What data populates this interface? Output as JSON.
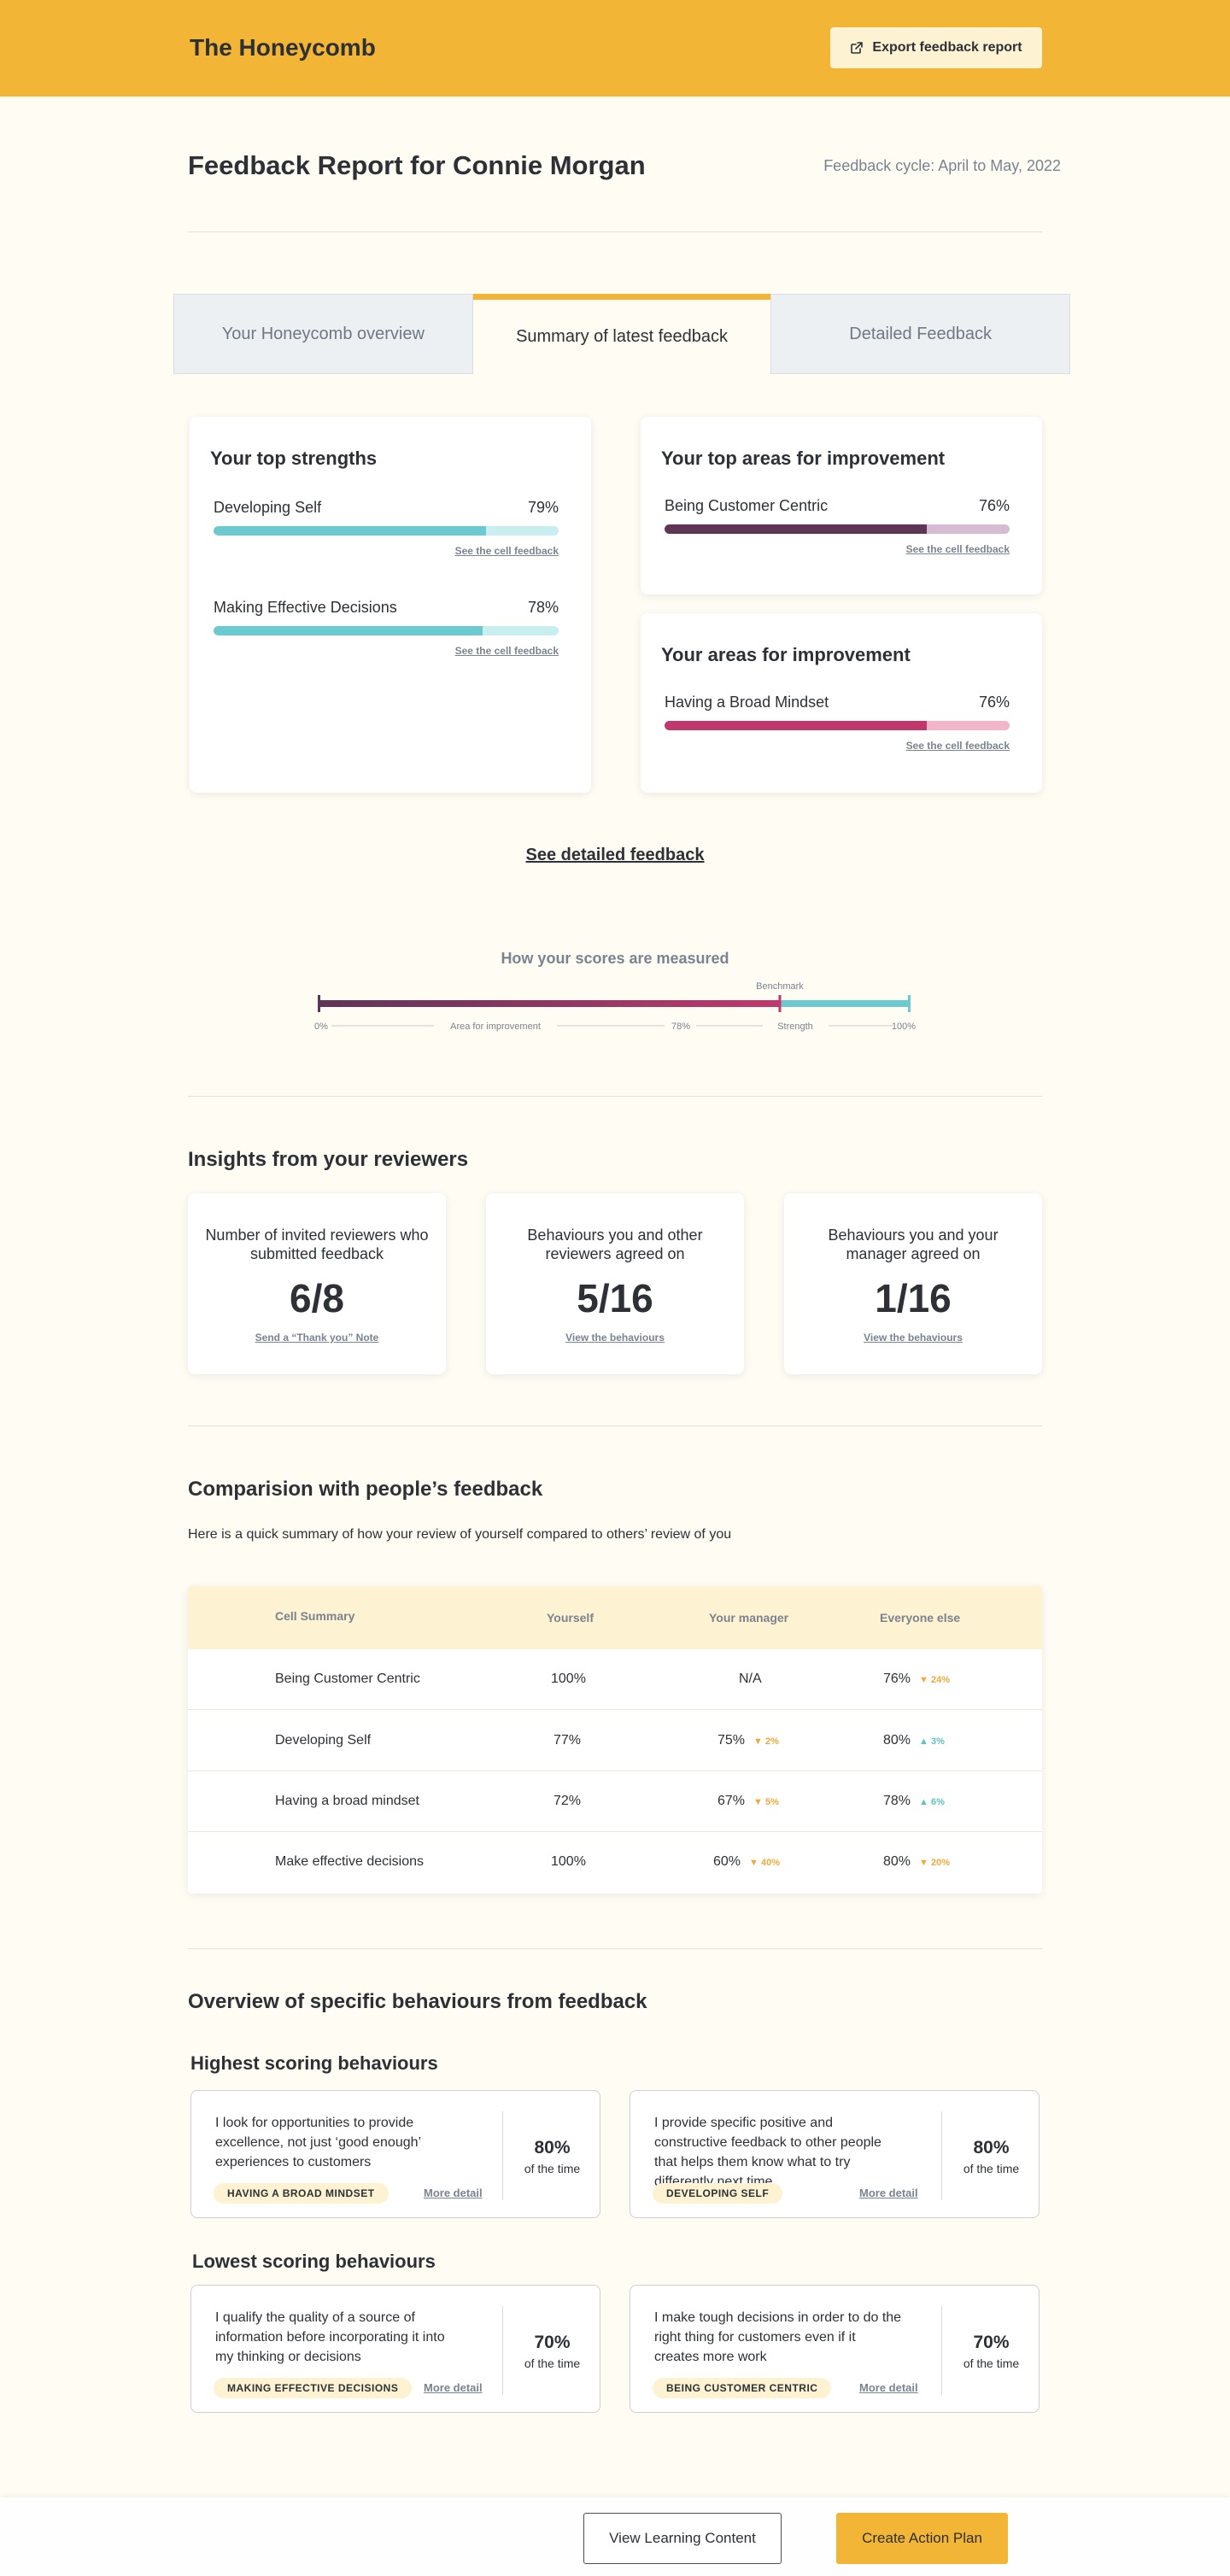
{
  "header": {
    "brand": "The Honeycomb",
    "export_label": "Export feedback report"
  },
  "report": {
    "title": "Feedback Report for Connie Morgan",
    "cycle": "Feedback cycle: April to May, 2022"
  },
  "tabs": [
    {
      "label": "Your Honeycomb overview",
      "active": false
    },
    {
      "label": "Summary of latest feedback",
      "active": true
    },
    {
      "label": "Detailed Feedback",
      "active": false
    }
  ],
  "strengths": {
    "heading": "Your top strengths",
    "items": [
      {
        "name": "Developing Self",
        "pct_label": "79%",
        "value": 79,
        "link": "See the cell feedback"
      },
      {
        "name": "Making Effective Decisions",
        "pct_label": "78%",
        "value": 78,
        "link": "See the cell feedback"
      }
    ]
  },
  "top_improvement": {
    "heading": "Your top areas for improvement",
    "items": [
      {
        "name": "Being Customer Centric",
        "pct_label": "76%",
        "value": 76,
        "link": "See the cell feedback"
      }
    ]
  },
  "improvement": {
    "heading": "Your areas for improvement",
    "items": [
      {
        "name": "Having a Broad Mindset",
        "pct_label": "76%",
        "value": 76,
        "link": "See the cell feedback"
      }
    ]
  },
  "detailed_link": "See detailed feedback",
  "scale": {
    "title": "How your scores are measured",
    "benchmark_label": "Benchmark",
    "benchmark_value": 78,
    "labels": {
      "start": "0%",
      "area": "Area for improvement",
      "mid": "78%",
      "strength": "Strength",
      "end": "100%"
    }
  },
  "insights": {
    "heading": "Insights from your reviewers",
    "cards": [
      {
        "label": "Number of invited reviewers who submitted feedback",
        "value": "6/8",
        "link": "Send a “Thank you” Note"
      },
      {
        "label": "Behaviours you and other reviewers agreed on",
        "value": "5/16",
        "link": "View the behaviours"
      },
      {
        "label": "Behaviours you and your manager agreed on",
        "value": "1/16",
        "link": "View the behaviours"
      }
    ]
  },
  "comparison": {
    "heading": "Comparision with people’s feedback",
    "subtitle": "Here is a quick summary of how your review of yourself compared to others’ review of you",
    "columns": [
      "Cell Summary",
      "Yourself",
      "Your manager",
      "Everyone else"
    ],
    "rows": [
      {
        "cell": "Being Customer Centric",
        "yourself": "100%",
        "manager": "N/A",
        "manager_delta": "",
        "manager_dir": "",
        "everyone": "76%",
        "everyone_delta": "▼ 24%",
        "everyone_dir": "down"
      },
      {
        "cell": "Developing Self",
        "yourself": "77%",
        "manager": "75%",
        "manager_delta": "▼ 2%",
        "manager_dir": "down",
        "everyone": "80%",
        "everyone_delta": "▲ 3%",
        "everyone_dir": "up"
      },
      {
        "cell": "Having a broad mindset",
        "yourself": "72%",
        "manager": "67%",
        "manager_delta": "▼ 5%",
        "manager_dir": "down",
        "everyone": "78%",
        "everyone_delta": "▲ 6%",
        "everyone_dir": "up"
      },
      {
        "cell": "Make effective decisions",
        "yourself": "100%",
        "manager": "60%",
        "manager_delta": "▼ 40%",
        "manager_dir": "down",
        "everyone": "80%",
        "everyone_delta": "▼ 20%",
        "everyone_dir": "down"
      }
    ]
  },
  "behaviours": {
    "heading": "Overview of specific behaviours from feedback",
    "highest": {
      "heading": "Highest scoring behaviours",
      "items": [
        {
          "text": "I look for opportunities to provide excellence, not just ‘good enough’ experiences to customers",
          "pct": "80%",
          "sub": "of the time",
          "tag": "HAVING A BROAD MINDSET",
          "more": "More detail"
        },
        {
          "text": "I provide specific positive and constructive feedback to other people that helps them know what to try differently next time",
          "pct": "80%",
          "sub": "of the time",
          "tag": "DEVELOPING SELF",
          "more": "More detail"
        }
      ]
    },
    "lowest": {
      "heading": "Lowest scoring behaviours",
      "items": [
        {
          "text": "I qualify the quality of a source of information before incorporating it into my thinking or decisions",
          "pct": "70%",
          "sub": "of the time",
          "tag": "MAKING EFFECTIVE DECISIONS",
          "more": "More detail"
        },
        {
          "text": "I make tough decisions in order to do the right thing for customers even if it creates more work",
          "pct": "70%",
          "sub": "of the time",
          "tag": "BEING CUSTOMER CENTRIC",
          "more": "More detail"
        }
      ]
    }
  },
  "footer": {
    "learning_label": "View Learning Content",
    "action_label": "Create Action Plan"
  },
  "colors": {
    "accent": "#f2b535",
    "strength_fill": "#6cc9cf",
    "strength_track": "#c9eef0",
    "top_improve_fill": "#5e3557",
    "top_improve_track": "#d5bcd2",
    "improve_fill": "#c0396c",
    "improve_track": "#f1b6c9"
  }
}
